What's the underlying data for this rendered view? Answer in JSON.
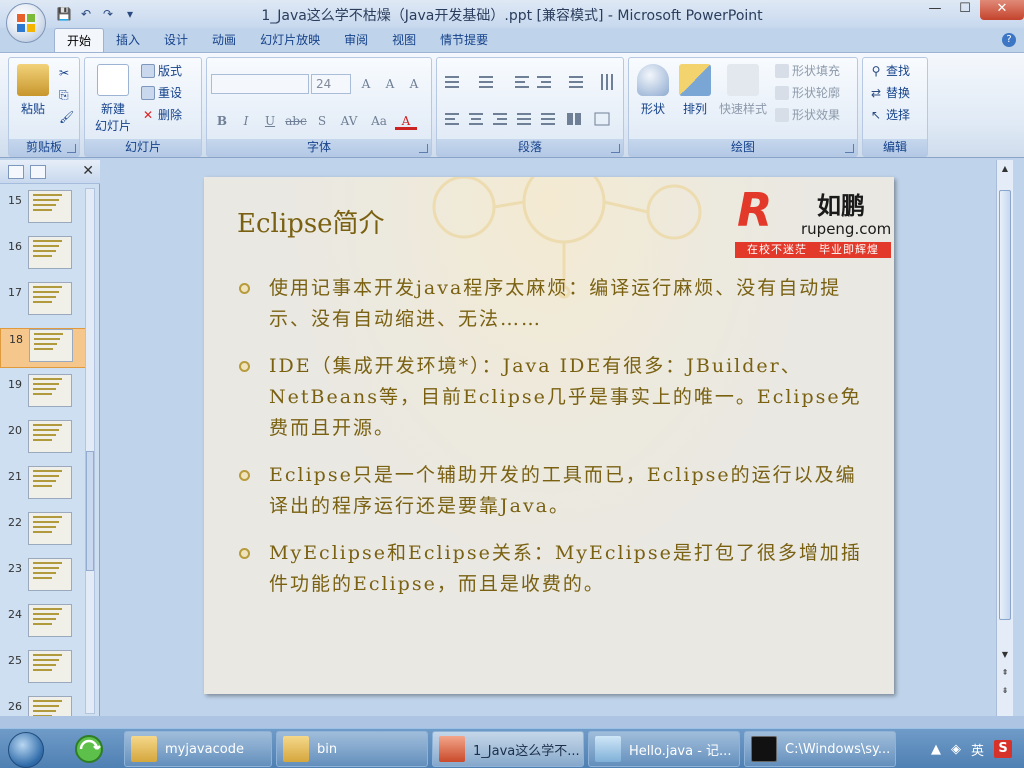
{
  "window": {
    "title": "1_Java这么学不枯燥（Java开发基础）.ppt [兼容模式] - Microsoft PowerPoint",
    "minimize": "—",
    "maximize": "☐",
    "close": "✕"
  },
  "quick_access": {
    "save": "💾",
    "undo": "↶",
    "redo": "↷",
    "more": "▾"
  },
  "tabs": [
    "开始",
    "插入",
    "设计",
    "动画",
    "幻灯片放映",
    "审阅",
    "视图",
    "情节提要"
  ],
  "help": "?",
  "ribbon": {
    "clipboard": {
      "label": "剪贴板",
      "paste": "粘贴",
      "cut": "✂",
      "copy": "⎘",
      "format_painter": "🖌"
    },
    "slides": {
      "label": "幻灯片",
      "new_slide": "新建",
      "new_slide2": "幻灯片",
      "layout": "版式",
      "reset": "重设",
      "delete": "删除"
    },
    "font": {
      "label": "字体",
      "font_name": "",
      "font_size": "24",
      "bold": "B",
      "italic": "I",
      "underline": "U",
      "strike": "abc",
      "shadow": "S",
      "spacing": "AV",
      "case": "Aa",
      "color": "A",
      "grow": "A",
      "shrink": "A",
      "clear": "A"
    },
    "paragraph": {
      "label": "段落"
    },
    "drawing": {
      "label": "绘图",
      "shapes": "形状",
      "arrange": "排列",
      "quick_styles": "快速样式",
      "shape_fill": "形状填充",
      "shape_outline": "形状轮廓",
      "shape_effects": "形状效果"
    },
    "editing": {
      "label": "编辑",
      "find": "查找",
      "replace": "替换",
      "select": "选择"
    }
  },
  "slide_pane": {
    "close": "✕",
    "thumbnails": [
      {
        "num": "15",
        "selected": false
      },
      {
        "num": "16",
        "selected": false
      },
      {
        "num": "17",
        "selected": false
      },
      {
        "num": "18",
        "selected": true
      },
      {
        "num": "19",
        "selected": false
      },
      {
        "num": "20",
        "selected": false
      },
      {
        "num": "21",
        "selected": false
      },
      {
        "num": "22",
        "selected": false
      },
      {
        "num": "23",
        "selected": false
      },
      {
        "num": "24",
        "selected": false
      },
      {
        "num": "25",
        "selected": false
      },
      {
        "num": "26",
        "selected": false
      }
    ]
  },
  "slide": {
    "title": "Eclipse简介",
    "logo": {
      "mark": "R",
      "cn": "如鹏",
      "en": "rupeng.com",
      "slogan": "在校不迷茫　毕业即辉煌"
    },
    "bullets": [
      "使用记事本开发java程序太麻烦：编译运行麻烦、没有自动提示、没有自动缩进、无法……",
      "IDE（集成开发环境*）：Java IDE有很多：JBuilder、NetBeans等，目前Eclipse几乎是事实上的唯一。Eclipse免费而且开源。",
      "Eclipse只是一个辅助开发的工具而已，Eclipse的运行以及编译出的程序运行还是要靠Java。",
      "MyEclipse和Eclipse关系：MyEclipse是打包了很多增加插件功能的Eclipse，而且是收费的。"
    ]
  },
  "taskbar": {
    "items": [
      {
        "label": "myjavacode",
        "icon": "folder-icon",
        "active": false
      },
      {
        "label": "bin",
        "icon": "folder-icon",
        "active": false
      },
      {
        "label": "1_Java这么学不...",
        "icon": "powerpoint-icon",
        "active": true
      },
      {
        "label": "Hello.java - 记...",
        "icon": "notepad-icon",
        "active": false
      },
      {
        "label": "C:\\Windows\\sy...",
        "icon": "cmd-icon",
        "active": false
      }
    ],
    "tray": {
      "arrow": "▲",
      "lang": "英",
      "ime": "S"
    }
  },
  "colors": {
    "slide_text": "#7a6112",
    "ribbon_text": "#15428b",
    "accent_red": "#e2392a",
    "selection": "#f6c78c"
  }
}
